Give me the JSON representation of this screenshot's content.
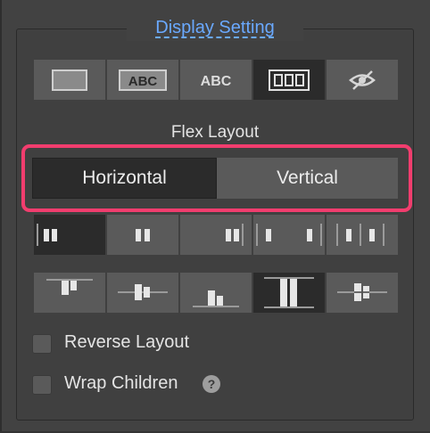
{
  "section_title": "Display Setting",
  "display_modes": [
    {
      "icon": "block-box-icon",
      "active": false
    },
    {
      "icon": "inline-block-abc-icon",
      "active": false
    },
    {
      "icon": "inline-abc-icon",
      "active": false
    },
    {
      "icon": "flex-columns-icon",
      "active": true
    },
    {
      "icon": "hidden-eye-icon",
      "active": false
    }
  ],
  "flex_layout": {
    "title": "Flex Layout",
    "directions": [
      {
        "label": "Horizontal",
        "active": true
      },
      {
        "label": "Vertical",
        "active": false
      }
    ]
  },
  "justify_options": [
    {
      "icon": "justify-start-icon",
      "active": true
    },
    {
      "icon": "justify-center-icon",
      "active": false
    },
    {
      "icon": "justify-end-icon",
      "active": false
    },
    {
      "icon": "justify-space-between-icon",
      "active": false
    },
    {
      "icon": "justify-space-around-icon",
      "active": false
    }
  ],
  "align_options": [
    {
      "icon": "align-top-icon",
      "active": false
    },
    {
      "icon": "align-center-icon",
      "active": false
    },
    {
      "icon": "align-bottom-icon",
      "active": false
    },
    {
      "icon": "align-stretch-icon",
      "active": true
    },
    {
      "icon": "align-baseline-icon",
      "active": false
    }
  ],
  "options": {
    "reverse_layout": {
      "label": "Reverse Layout",
      "checked": false
    },
    "wrap_children": {
      "label": "Wrap Children",
      "checked": false
    },
    "help_glyph": "?"
  }
}
